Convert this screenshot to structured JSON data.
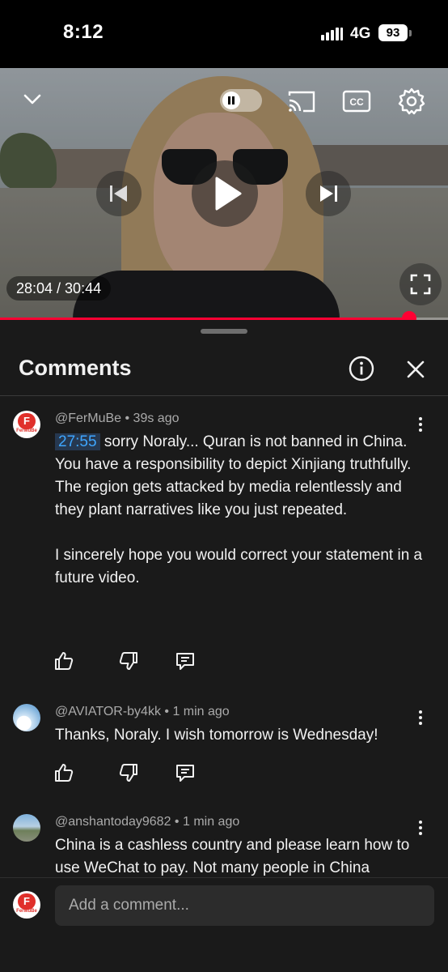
{
  "status_bar": {
    "time": "8:12",
    "network": "4G",
    "battery": "93"
  },
  "video": {
    "timecode": "28:04 / 30:44",
    "progress_fraction": 0.913,
    "accent_color": "#ff0033",
    "icons": [
      "chevron-down-icon",
      "pause-toggle",
      "cast-icon",
      "captions-icon",
      "settings-gear-icon",
      "previous-icon",
      "play-icon",
      "next-icon",
      "fullscreen-icon"
    ]
  },
  "comments_panel": {
    "title": "Comments",
    "comments": [
      {
        "author": "@FerMuBe",
        "age": "39s ago",
        "avatar_text": "F",
        "avatar_subtext": "FerMuBe",
        "timestamp_link": "27:55",
        "lines": [
          "sorry Noraly... Quran is not banned in China.",
          "You have a responsibility to depict Xinjiang truthfully.",
          "The region gets attacked by media relentlessly and they plant narratives like you just repeated.",
          "I sincerely hope you would correct your statement in a future video."
        ]
      },
      {
        "author": "@AVIATOR-by4kk",
        "age": "1 min ago",
        "text": "Thanks, Noraly. I wish tomorrow is Wednesday!"
      },
      {
        "author": "@anshantoday9682",
        "age": "1 min ago",
        "text": "China is a cashless country and please learn how to use WeChat to pay. Not many people in China"
      }
    ]
  },
  "composer": {
    "placeholder": "Add a comment...",
    "avatar_text": "F",
    "avatar_subtext": "FerMuBe"
  }
}
